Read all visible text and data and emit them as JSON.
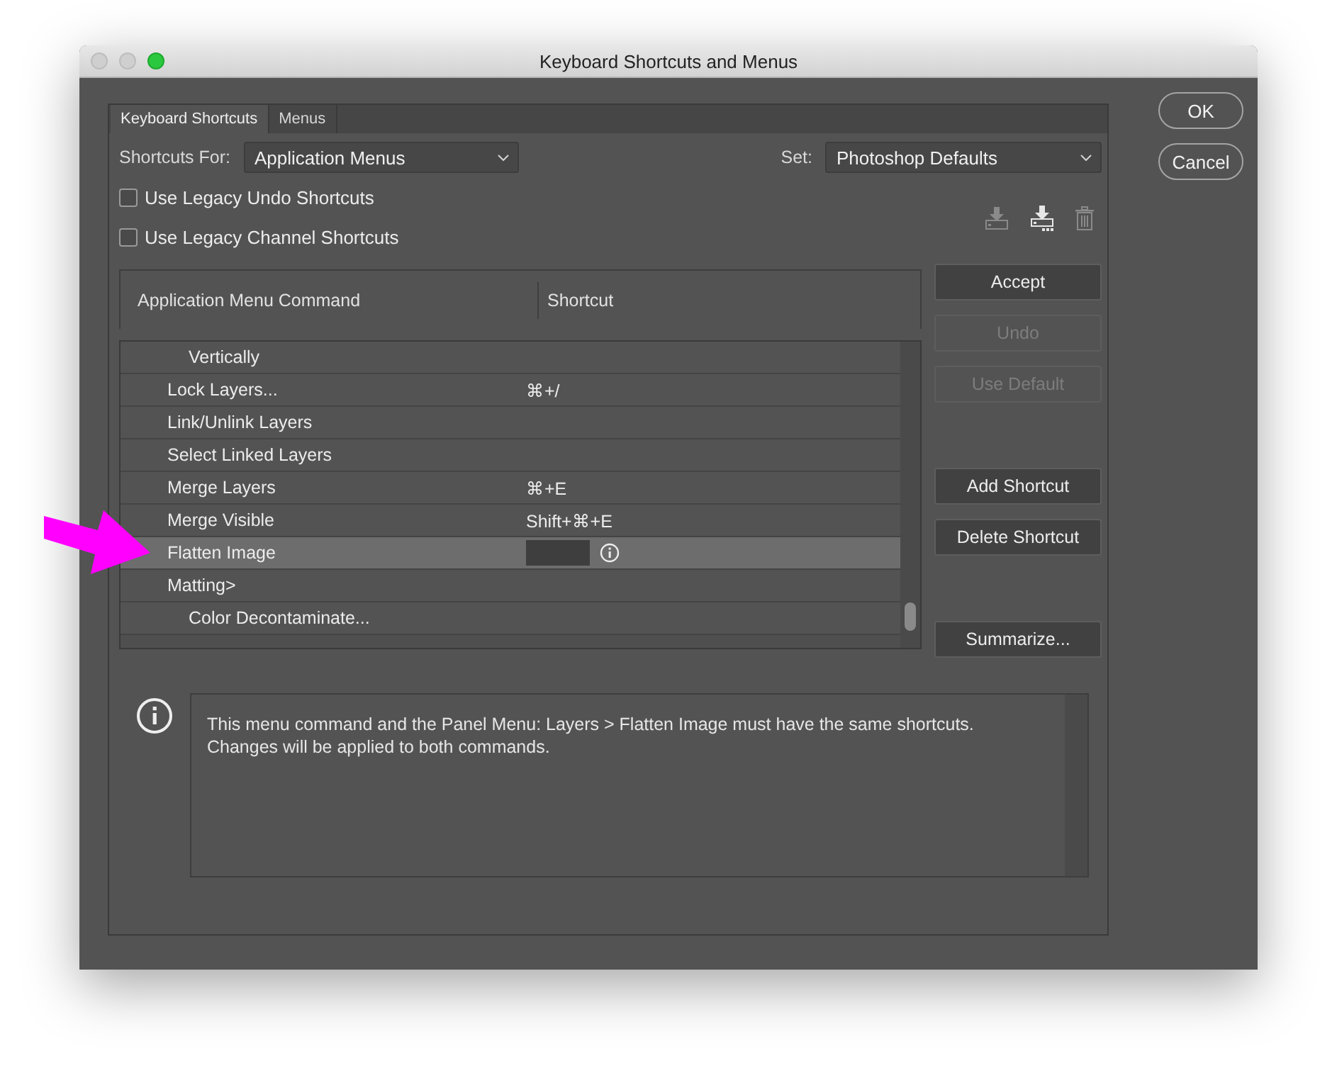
{
  "window": {
    "title": "Keyboard Shortcuts and Menus"
  },
  "tabs": [
    {
      "label": "Keyboard Shortcuts",
      "selected": true
    },
    {
      "label": "Menus",
      "selected": false
    }
  ],
  "shortcuts_for": {
    "label": "Shortcuts For:",
    "value": "Application Menus"
  },
  "set": {
    "label": "Set:",
    "value": "Photoshop Defaults"
  },
  "checkboxes": [
    {
      "label": "Use Legacy Undo Shortcuts",
      "checked": false
    },
    {
      "label": "Use Legacy Channel Shortcuts",
      "checked": false
    }
  ],
  "set_icons": [
    {
      "kind": "download",
      "disabled": true
    },
    {
      "kind": "download-new",
      "disabled": false
    },
    {
      "kind": "trash",
      "disabled": true
    }
  ],
  "table": {
    "columns": [
      "Application Menu Command",
      "Shortcut"
    ],
    "rows": [
      {
        "children": [
          {
            "label": "Vertically",
            "selected": false
          }
        ]
      },
      {
        "label": "Lock Layers...",
        "shortcut": "⌘+/",
        "selected": false
      },
      {
        "label": "Link/Unlink Layers",
        "selected": false
      },
      {
        "label": "Select Linked Layers",
        "selected": false
      },
      {
        "label": "Merge Layers",
        "shortcut": "⌘+E",
        "selected": false
      },
      {
        "label": "Merge Visible",
        "shortcut": "Shift+⌘+E",
        "selected": false
      },
      {
        "label": "Flatten Image",
        "selected": true,
        "editing": true
      },
      {
        "label": "Matting>",
        "selected": false,
        "children": [
          {
            "label": "Color Decontaminate...",
            "selected": false
          }
        ]
      }
    ]
  },
  "button_groups": [
    [
      {
        "label": "Accept",
        "disabled": false
      },
      {
        "label": "Undo",
        "disabled": true
      },
      {
        "label": "Use Default",
        "disabled": true
      }
    ],
    [
      {
        "label": "Add Shortcut",
        "disabled": false
      },
      {
        "label": "Delete Shortcut",
        "disabled": false
      }
    ],
    [
      {
        "label": "Summarize...",
        "disabled": false
      }
    ]
  ],
  "message": {
    "text": "This menu command and the Panel Menu: Layers > Flatten Image must have the same shortcuts.\nChanges will be applied to both commands."
  },
  "dialog_buttons": [
    {
      "label": "OK"
    },
    {
      "label": "Cancel"
    }
  ],
  "annotations": [
    {
      "kind": "arrow",
      "color": "#ff00ff"
    }
  ]
}
